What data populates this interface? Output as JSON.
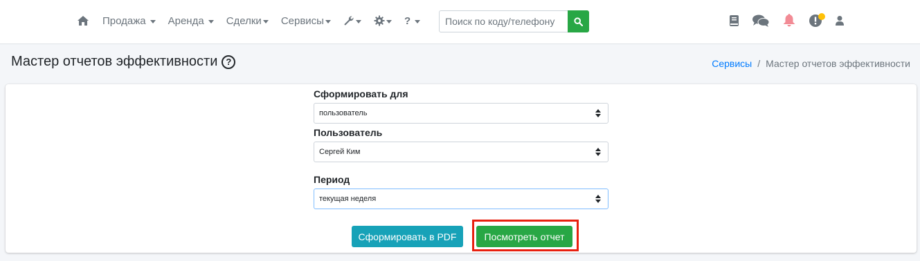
{
  "nav": {
    "items": [
      {
        "label": "Продажа"
      },
      {
        "label": "Аренда"
      },
      {
        "label": "Сделки"
      },
      {
        "label": "Сервисы"
      }
    ],
    "tools_label": "",
    "settings_label": "",
    "help_label": "?",
    "search_placeholder": "Поиск по коду/телефону"
  },
  "header": {
    "title": "Мастер отчетов эффективности",
    "help_glyph": "?",
    "breadcrumb": {
      "link": "Сервисы",
      "separator": "/",
      "current": "Мастер отчетов эффективности"
    }
  },
  "form": {
    "for_label": "Сформировать для",
    "for_value": "пользователь",
    "user_label": "Пользователь",
    "user_value": "Сергей Ким",
    "period_label": "Период",
    "period_value": "текущая неделя"
  },
  "buttons": {
    "pdf": "Сформировать в PDF",
    "view": "Посмотреть отчет"
  },
  "colors": {
    "primary_green": "#28a745",
    "info_teal": "#17a2b8",
    "link_blue": "#007bff",
    "bell_red": "#f28b95",
    "highlight_red": "#e8200f"
  }
}
